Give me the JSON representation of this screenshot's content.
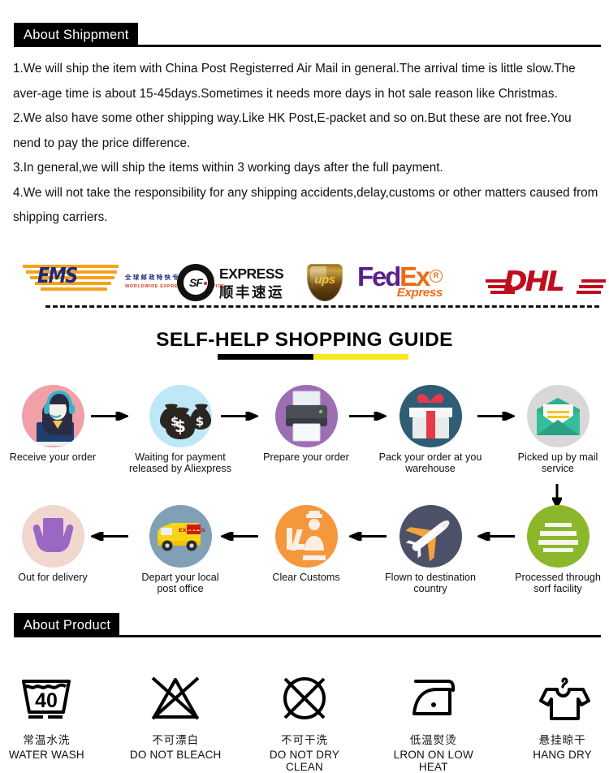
{
  "sections": {
    "shipment_header": "About Shippment",
    "product_header": "About Product"
  },
  "shipment_paragraphs": [
    "1.We will ship the item with China Post Registerred Air Mail in general.The arrival time is little slow.The aver-age time is about 15-45days.Sometimes it needs  more days in hot sale reason like Christmas.",
    "2.We also have some other shipping way.Like HK Post,E-packet and so on.But these are not free.You nend to pay the price difference.",
    "3.In general,we will ship the items within 3 working days after the full payment.",
    "4.We will not take the responsibility for any shipping accidents,delay,customs or other matters caused from shipping carriers."
  ],
  "carriers": [
    {
      "id": "ems",
      "name": "EMS",
      "cn": "全球邮政特快专递",
      "en": "WORLDWIDE EXPRESS MAIL SERVICE"
    },
    {
      "id": "sf",
      "name": "SF",
      "en": "EXPRESS",
      "cn": "顺丰速运"
    },
    {
      "id": "ups",
      "name": "ups"
    },
    {
      "id": "fedex",
      "fed": "Fed",
      "ex": "Ex",
      "reg": "R",
      "sub": "Express"
    },
    {
      "id": "dhl",
      "name": "DHL"
    }
  ],
  "guide": {
    "title": "SELF-HELP SHOPPING GUIDE",
    "underline_colors": {
      "left": "#000000",
      "right": "#F7E81C"
    }
  },
  "flow_row_1": [
    {
      "label": "Receive your order",
      "icon": "customer-service-icon",
      "circle_color": "#F0A0A6"
    },
    {
      "label": "Waiting for payment\nreleased by Aliexpress",
      "icon": "money-bags-icon",
      "circle_color": "#BFE8F7"
    },
    {
      "label": "Prepare your order",
      "icon": "printer-icon",
      "circle_color": "#9C6EB4"
    },
    {
      "label": "Pack your order at you\nwarehouse",
      "icon": "gift-box-icon",
      "circle_color": "#2F5D74"
    },
    {
      "label": "Picked up by mail\nservice",
      "icon": "envelope-icon",
      "circle_color": "#D8D8D8"
    }
  ],
  "flow_row_2": [
    {
      "label": "Out for delivery",
      "icon": "hands-package-icon",
      "circle_color": "#F0D8CE"
    },
    {
      "label": "Depart your local\npost office",
      "icon": "delivery-van-icon",
      "circle_color": "#7FA0B5"
    },
    {
      "label": "Clear Customs",
      "icon": "customs-officer-icon",
      "circle_color": "#F5973D"
    },
    {
      "label": "Flown to destination\ncountry",
      "icon": "airplane-icon",
      "circle_color": "#4C5168"
    },
    {
      "label": "Processed through\nsorf facility",
      "icon": "sorting-lines-icon",
      "circle_color": "#8CB72B"
    }
  ],
  "care_instructions": [
    {
      "icon": "water-wash-40-icon",
      "temperature": "40",
      "cn": "常温水洗",
      "en": "WATER WASH"
    },
    {
      "icon": "do-not-bleach-icon",
      "cn": "不可漂白",
      "en": "DO NOT BLEACH"
    },
    {
      "icon": "do-not-dry-clean-icon",
      "cn": "不可干洗",
      "en": "DO NOT DRY CLEAN"
    },
    {
      "icon": "iron-low-heat-icon",
      "cn": "低温熨烫",
      "en": "LRON ON LOW HEAT"
    },
    {
      "icon": "hang-dry-icon",
      "cn": "悬挂晾干",
      "en": "HANG DRY"
    }
  ]
}
